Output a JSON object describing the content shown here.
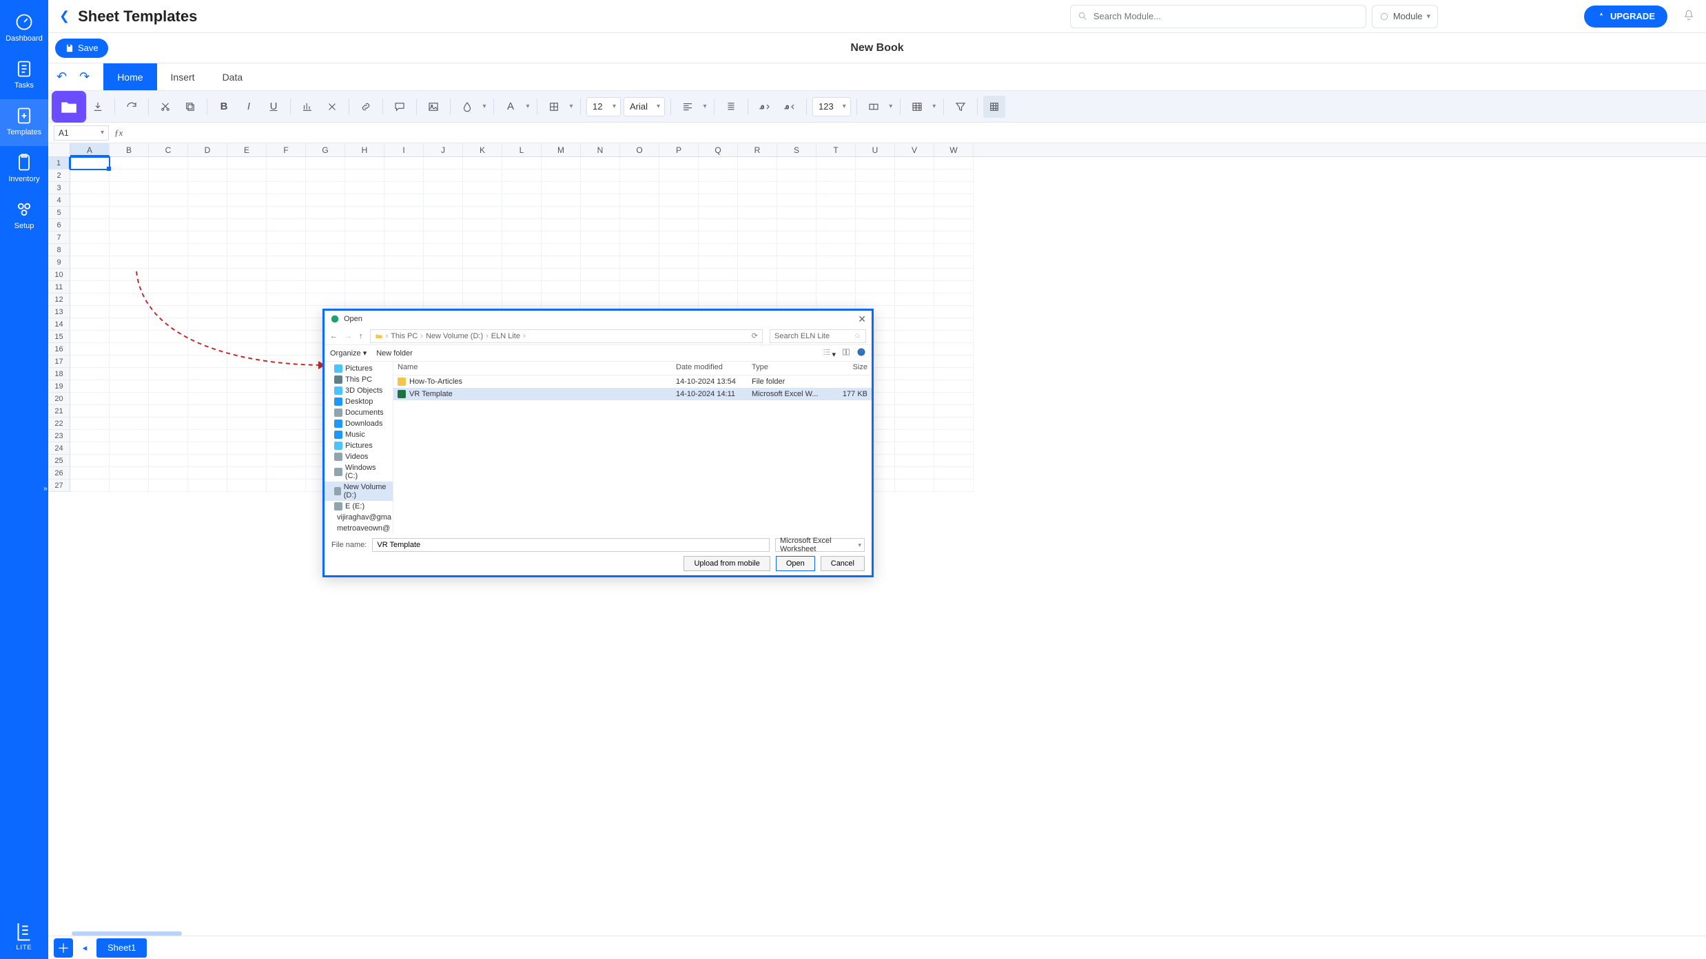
{
  "header": {
    "page_title": "Sheet Templates",
    "search_placeholder": "Search Module...",
    "module_label": "Module",
    "upgrade_label": "UPGRADE"
  },
  "sidebar": {
    "items": [
      {
        "label": "Dashboard"
      },
      {
        "label": "Tasks"
      },
      {
        "label": "Templates"
      },
      {
        "label": "Inventory"
      },
      {
        "label": "Setup"
      }
    ],
    "lite_label": "LITE"
  },
  "book": {
    "save_label": "Save",
    "title": "New Book"
  },
  "tabs": [
    "Home",
    "Insert",
    "Data"
  ],
  "toolbar": {
    "font_size": "12",
    "font_name": "Arial",
    "num_format": "123"
  },
  "formula_bar": {
    "cell_ref": "A1"
  },
  "columns": [
    "A",
    "B",
    "C",
    "D",
    "E",
    "F",
    "G",
    "H",
    "I",
    "J",
    "K",
    "L",
    "M",
    "N",
    "O",
    "P",
    "Q",
    "R",
    "S",
    "T",
    "U",
    "V",
    "W"
  ],
  "rows": [
    1,
    2,
    3,
    4,
    5,
    6,
    7,
    8,
    9,
    10,
    11,
    12,
    13,
    14,
    15,
    16,
    17,
    18,
    19,
    20,
    21,
    22,
    23,
    24,
    25,
    26,
    27
  ],
  "sheet_tabs": [
    "Sheet1"
  ],
  "dialog": {
    "title": "Open",
    "breadcrumb": [
      "This PC",
      "New Volume (D:)",
      "ELN Lite"
    ],
    "search_placeholder": "Search ELN Lite",
    "organize": "Organize",
    "new_folder": "New folder",
    "tree": [
      {
        "label": "Pictures",
        "icon": "pic"
      },
      {
        "label": "This PC",
        "icon": "pc"
      },
      {
        "label": "3D Objects",
        "icon": "3d"
      },
      {
        "label": "Desktop",
        "icon": "desk"
      },
      {
        "label": "Documents",
        "icon": "doc"
      },
      {
        "label": "Downloads",
        "icon": "dl"
      },
      {
        "label": "Music",
        "icon": "mus"
      },
      {
        "label": "Pictures",
        "icon": "pic"
      },
      {
        "label": "Videos",
        "icon": "vid"
      },
      {
        "label": "Windows (C:)",
        "icon": "drv"
      },
      {
        "label": "New Volume (D:)",
        "icon": "drv",
        "selected": true
      },
      {
        "label": "E (E:)",
        "icon": "drv"
      },
      {
        "label": "vijiraghav@gma",
        "icon": "gd"
      },
      {
        "label": "metroaveown@",
        "icon": "gd"
      }
    ],
    "list_cols": {
      "name": "Name",
      "date": "Date modified",
      "type": "Type",
      "size": "Size"
    },
    "files": [
      {
        "name": "How-To-Articles",
        "date": "14-10-2024 13:54",
        "type": "File folder",
        "size": "",
        "icon": "folder"
      },
      {
        "name": "VR Template",
        "date": "14-10-2024 14:11",
        "type": "Microsoft Excel W...",
        "size": "177 KB",
        "icon": "xls",
        "selected": true
      }
    ],
    "filename_label": "File name:",
    "filename_value": "VR Template",
    "filter": "Microsoft Excel Worksheet",
    "btn_upload": "Upload from mobile",
    "btn_open": "Open",
    "btn_cancel": "Cancel"
  }
}
